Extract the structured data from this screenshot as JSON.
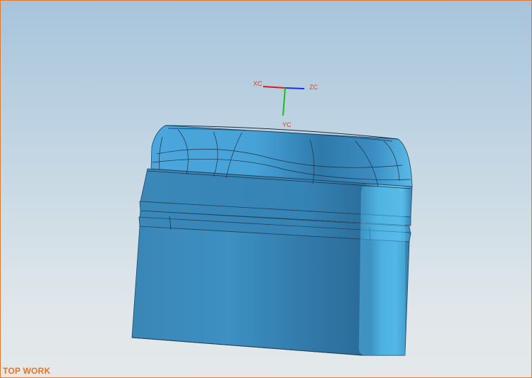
{
  "viewport": {
    "view_name": "TOP WORK"
  },
  "triad": {
    "x_label": "XC",
    "y_label": "YC",
    "z_label": "ZC",
    "x_color": "#e01818",
    "y_color": "#18c018",
    "z_color": "#1830e0"
  },
  "model": {
    "body_color": "#3c93c8",
    "edge_color": "#1f3040",
    "icon": "3d-bottle-cap-model"
  },
  "colors": {
    "border": "#e07a2a",
    "view_label": "#e8741e"
  }
}
